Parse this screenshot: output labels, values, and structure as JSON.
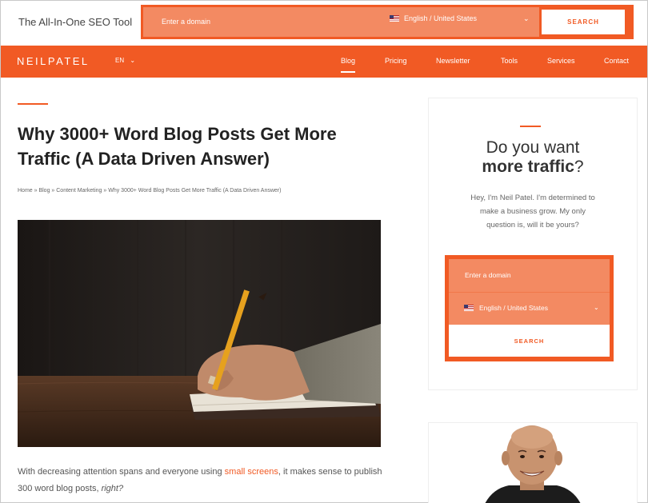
{
  "header": {
    "tagline": "The All-In-One SEO Tool",
    "search": {
      "placeholder": "Enter a domain",
      "language": "English / United States",
      "button": "SEARCH"
    }
  },
  "nav": {
    "logo": "NEILPATEL",
    "lang": "EN",
    "items": [
      "Blog",
      "Pricing",
      "Newsletter",
      "Tools",
      "Services",
      "Contact"
    ],
    "active": "Blog"
  },
  "article": {
    "title": "Why 3000+ Word Blog Posts Get More Traffic (A Data Driven Answer)",
    "breadcrumb": "Home » Blog » Content Marketing » Why 3000+ Word Blog Posts Get More Traffic (A Data Driven Answer)",
    "intro_before": "With decreasing attention spans and everyone using ",
    "intro_link": "small screens",
    "intro_after": ", it makes sense to publish 300 word blog posts, ",
    "intro_italic": "right?"
  },
  "sidebar": {
    "question_line1": "Do you want",
    "question_bold": "more traffic",
    "question_mark": "?",
    "description": "Hey, I'm Neil Patel. I'm determined to make a business grow. My only question is, will it be yours?",
    "form": {
      "placeholder": "Enter a domain",
      "language": "English / United States",
      "button": "SEARCH"
    }
  },
  "colors": {
    "brand": "#f15a24",
    "field": "#f38a62"
  }
}
